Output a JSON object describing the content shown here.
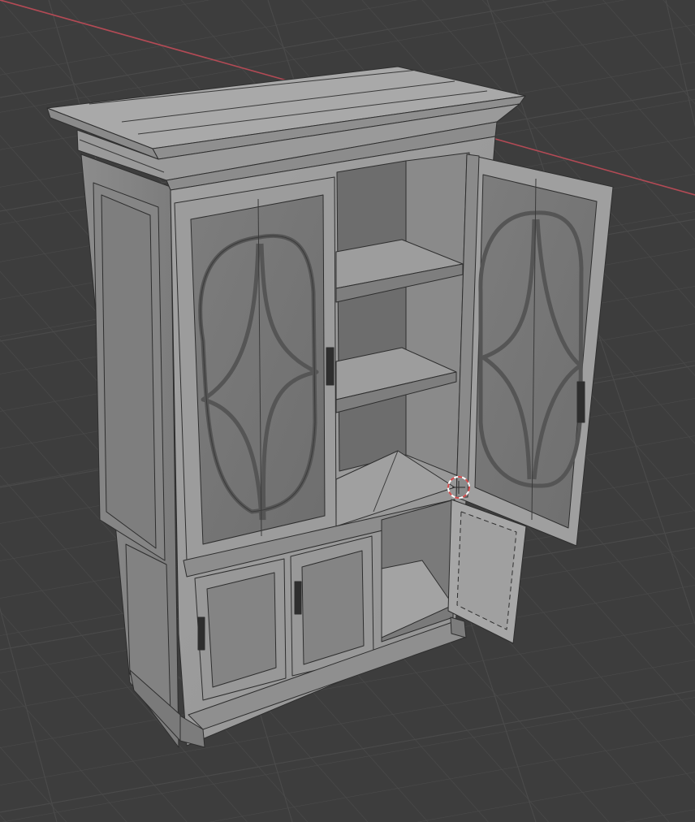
{
  "viewport": {
    "background_color": "#3d3d3d",
    "grid_color": "#4a4a4a",
    "x_axis_color": "#b34a55",
    "shading": "solid",
    "overlay": "wireframe"
  },
  "model": {
    "object": "cabinet",
    "upper_doors_open": 1,
    "upper_doors_closed": 1,
    "shelves": 2,
    "lower_doors_closed": 2,
    "lower_doors_open": 1
  },
  "cursor_3d": {
    "icon": "3d-cursor-icon",
    "color_a": "#d24a4a",
    "color_b": "#ffffff"
  }
}
